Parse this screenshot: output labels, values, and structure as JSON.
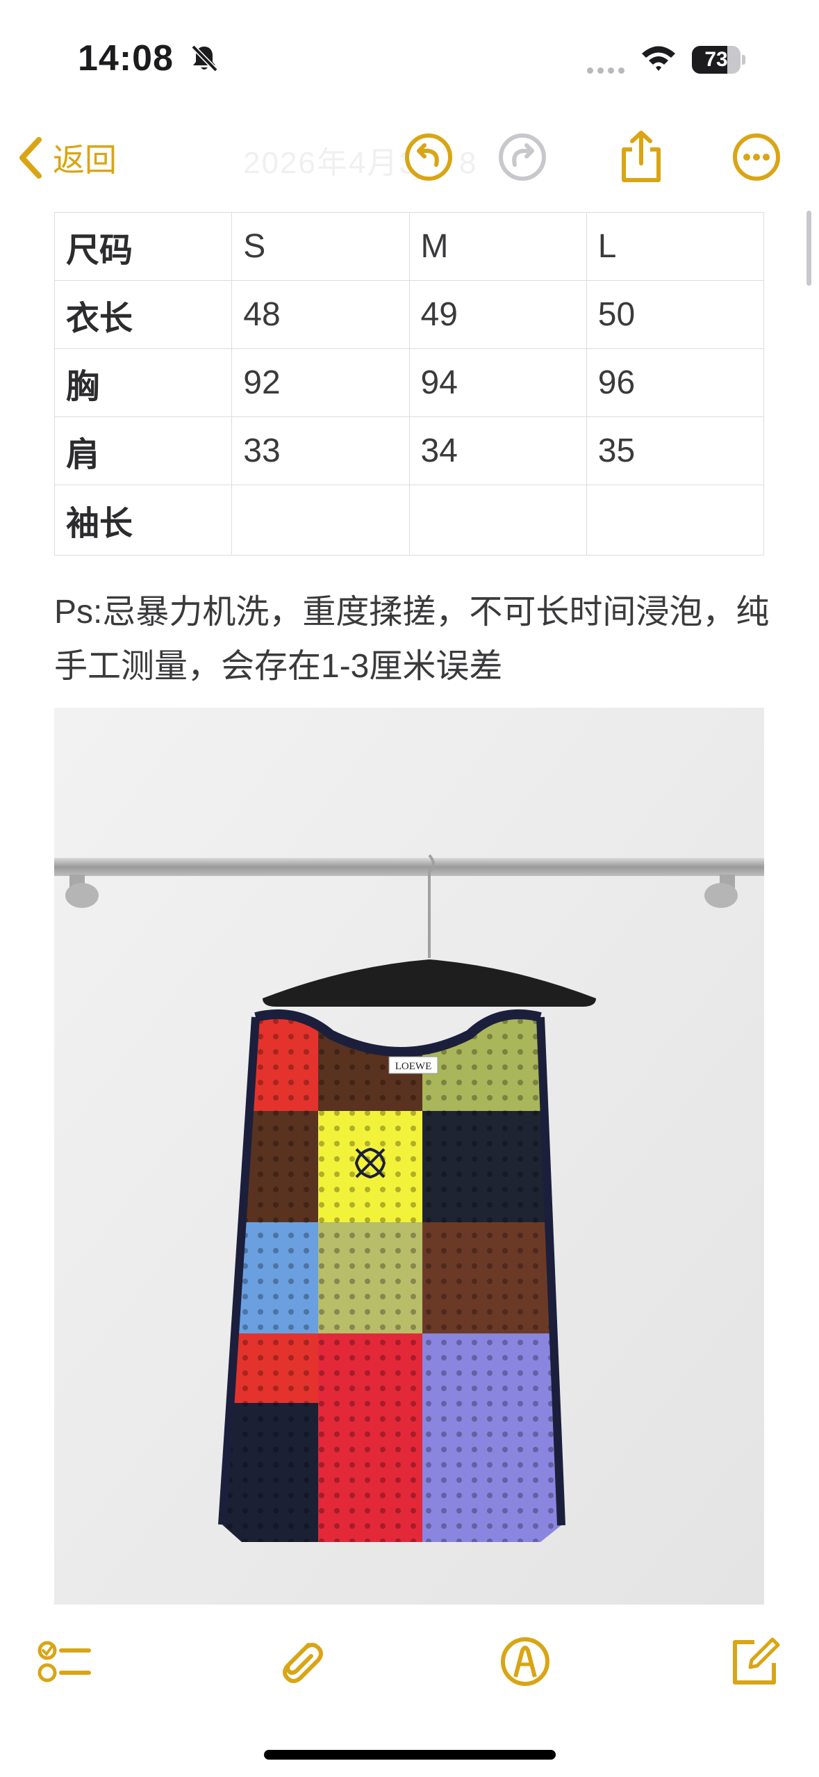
{
  "status_bar": {
    "time": "14:08",
    "battery": "73",
    "battery_level": 0.73
  },
  "nav": {
    "back_label": "返回",
    "title": "2026年4月3日 8"
  },
  "size_table": {
    "rows": [
      [
        "尺码",
        "S",
        "M",
        "L"
      ],
      [
        "衣长",
        "48",
        "49",
        "50"
      ],
      [
        "胸",
        "92",
        "94",
        "96"
      ],
      [
        "肩",
        "33",
        "34",
        "35"
      ],
      [
        "袖长",
        "",
        "",
        ""
      ]
    ]
  },
  "note": {
    "text": "Ps:忌暴力机洗，重度揉搓，不可长时间浸泡，纯手工测量，会存在1-3厘米误差"
  },
  "photo": {
    "label_text": "LOEWE"
  },
  "colors": {
    "accent": "#d9a514",
    "disabled": "#c7c7cc"
  },
  "icons": [
    "back-chevron-icon",
    "undo-icon",
    "redo-icon",
    "share-icon",
    "more-icon",
    "checklist-icon",
    "attachment-icon",
    "markup-icon",
    "compose-icon"
  ]
}
